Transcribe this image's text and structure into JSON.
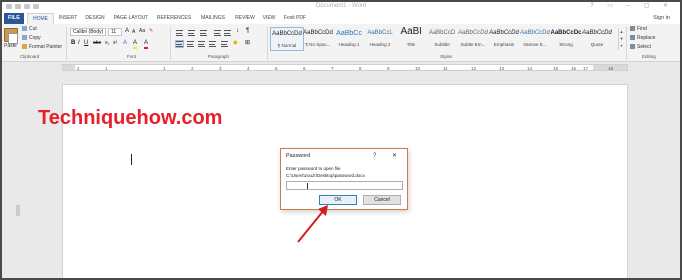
{
  "window": {
    "title": "Document1 - Word",
    "sign_in": "Sign in"
  },
  "tabs": {
    "file": "FILE",
    "items": [
      "HOME",
      "INSERT",
      "DESIGN",
      "PAGE LAYOUT",
      "REFERENCES",
      "MAILINGS",
      "REVIEW",
      "VIEW",
      "Foxit PDF"
    ],
    "active": "HOME"
  },
  "ribbon": {
    "clipboard": {
      "paste_label": "Paste",
      "cut": "Cut",
      "copy": "Copy",
      "format_painter": "Format Painter",
      "group_label": "Clipboard"
    },
    "font": {
      "font_name": "Calibri (Body)",
      "font_size": "11",
      "group_label": "Font",
      "bold": "B",
      "italic": "I",
      "underline": "U",
      "strike": "abc",
      "sub": "x₂",
      "sup": "x²",
      "grow": "A",
      "shrink": "A",
      "case": "Aa",
      "highlight": "A",
      "color": "A"
    },
    "paragraph": {
      "group_label": "Paragraph",
      "pilcrow": "¶"
    },
    "styles": {
      "group_label": "Styles",
      "items": [
        {
          "sample": "AaBbCcDd",
          "name": "¶ Normal",
          "selected": true
        },
        {
          "sample": "AaBbCcDd",
          "name": "¶ No Spac..."
        },
        {
          "sample": "AaBbCc",
          "name": "Heading 1"
        },
        {
          "sample": "AaBbCcL",
          "name": "Heading 2"
        },
        {
          "sample": "AaBl",
          "name": "Title"
        },
        {
          "sample": "AaBbCcD",
          "name": "Subtitle"
        },
        {
          "sample": "AaBbCcDd",
          "name": "Subtle Em..."
        },
        {
          "sample": "AaBbCcDd",
          "name": "Emphasis"
        },
        {
          "sample": "AaBbCcDd",
          "name": "Intense E..."
        },
        {
          "sample": "AaBbCcDc",
          "name": "Strong"
        },
        {
          "sample": "AaBbCcDd",
          "name": "Quote"
        }
      ]
    },
    "editing": {
      "find": "Find",
      "replace": "Replace",
      "select": "Select",
      "group_label": "Editing"
    }
  },
  "ruler": {
    "numbers": [
      "2",
      "1",
      "1",
      "2",
      "3",
      "4",
      "5",
      "6",
      "7",
      "8",
      "9",
      "10",
      "11",
      "12",
      "13",
      "14",
      "15",
      "16",
      "17",
      "18"
    ]
  },
  "document": {
    "watermark": "Techniquehow.com"
  },
  "dialog": {
    "title": "Password",
    "help": "?",
    "close": "✕",
    "prompt": "Enter password to open file",
    "path": "C:\\Users\\zouzr\\Desktop\\password.docx",
    "ok": "OK",
    "cancel": "Cancel"
  },
  "colors": {
    "accent": "#2b579a",
    "watermark": "#e8202a",
    "dialog_border": "#d07a48",
    "ok_border": "#3c7fb1",
    "arrow": "#d01f1f"
  }
}
